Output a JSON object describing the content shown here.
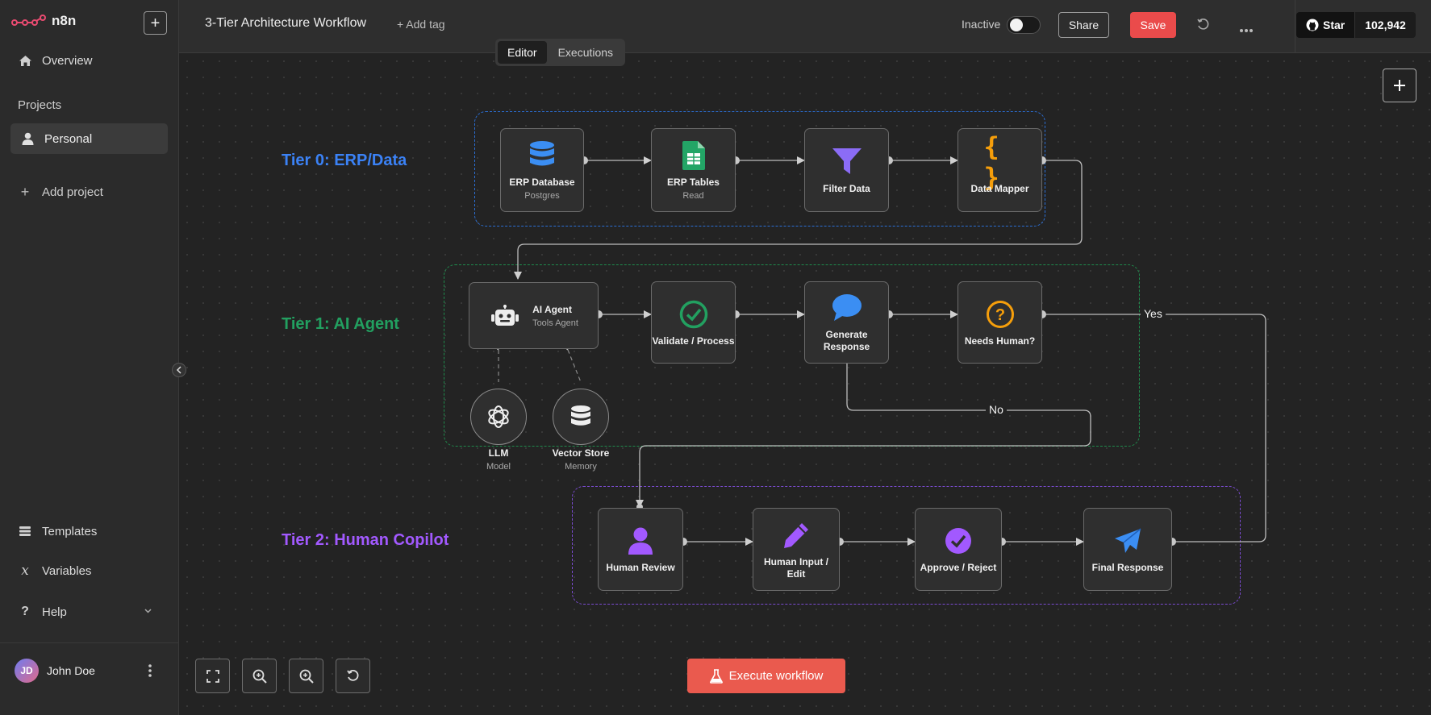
{
  "sidebar": {
    "logo": "n8n",
    "new_button": "+",
    "overview": "Overview",
    "projects_heading": "Projects",
    "personal": "Personal",
    "add_project": "Add project",
    "templates": "Templates",
    "variables": "Variables",
    "help": "Help",
    "user": {
      "initials": "JD",
      "name": "John Doe"
    }
  },
  "topbar": {
    "workflow_title": "3-Tier Architecture Workflow",
    "add_tag": "+ Add tag",
    "status_label": "Inactive",
    "share": "Share",
    "save": "Save",
    "github_star": "Star",
    "github_count": "102,942",
    "tabs": [
      "Editor",
      "Executions"
    ],
    "active_tab": "Editor"
  },
  "canvas": {
    "tiers": [
      {
        "label": "Tier 0: ERP/Data",
        "color": "#3b82f6"
      },
      {
        "label": "Tier 1: AI Agent",
        "color": "#22a060"
      },
      {
        "label": "Tier 2: Human Copilot",
        "color": "#a259ff"
      }
    ],
    "nodes": {
      "erp_db": {
        "name": "ERP Database",
        "sub": "Postgres"
      },
      "erp_tables": {
        "name": "ERP Tables",
        "sub": "Read"
      },
      "filter": {
        "name": "Filter Data"
      },
      "mapper": {
        "name": "Data Mapper"
      },
      "agent": {
        "name": "AI Agent",
        "sub": "Tools Agent"
      },
      "validate": {
        "name": "Validate / Process"
      },
      "generate": {
        "name": "Generate Response"
      },
      "needs_human": {
        "name": "Needs Human?"
      },
      "llm": {
        "name": "LLM",
        "sub": "Model"
      },
      "vector": {
        "name": "Vector Store",
        "sub": "Memory"
      },
      "review": {
        "name": "Human Review"
      },
      "input_edit": {
        "name": "Human Input / Edit"
      },
      "approve": {
        "name": "Approve / Reject"
      },
      "final": {
        "name": "Final Response"
      }
    },
    "edge_labels": {
      "yes": "Yes",
      "no": "No"
    },
    "execute_button": "Execute workflow",
    "icons": [
      "fit-view-icon",
      "zoom-in-icon",
      "zoom-out-icon",
      "reset-zoom-icon"
    ]
  }
}
